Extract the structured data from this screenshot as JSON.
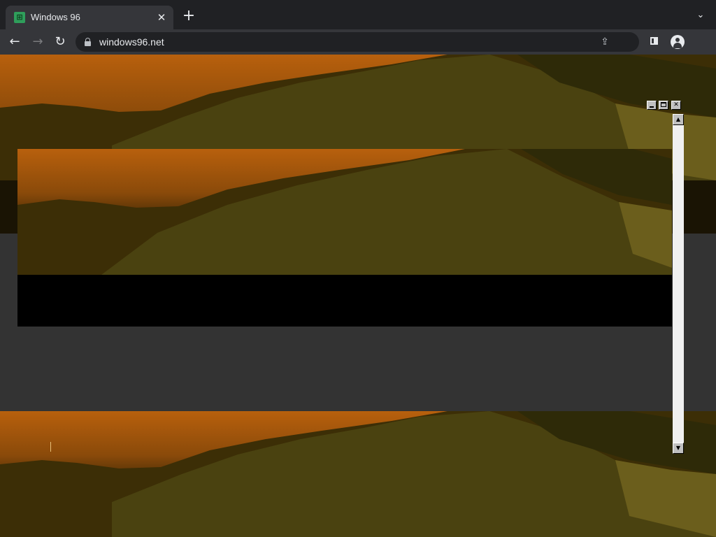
{
  "browser": {
    "tab": {
      "title": "Windows 96",
      "favicon": "windows96-icon",
      "close_glyph": "✕"
    },
    "new_tab_glyph": "+",
    "tab_list_glyph": "⌄",
    "nav": {
      "back_glyph": "←",
      "forward_glyph": "→",
      "reload_glyph": "↻"
    },
    "omnibox": {
      "url": "windows96.net"
    },
    "share_glyph": "⇪"
  },
  "page": {
    "background_color": "#333333",
    "window_controls": {
      "minimize_icon": "minimize-icon",
      "maximize_icon": "maximize-icon",
      "close_glyph": "✕"
    },
    "scrollbar": {
      "up_glyph": "▲",
      "down_glyph": "▼"
    }
  },
  "colors": {
    "chrome_dark": "#202124",
    "chrome_toolbar": "#35363a",
    "sky_orange": "#b8600d",
    "hill_olive": "#4a4210"
  }
}
